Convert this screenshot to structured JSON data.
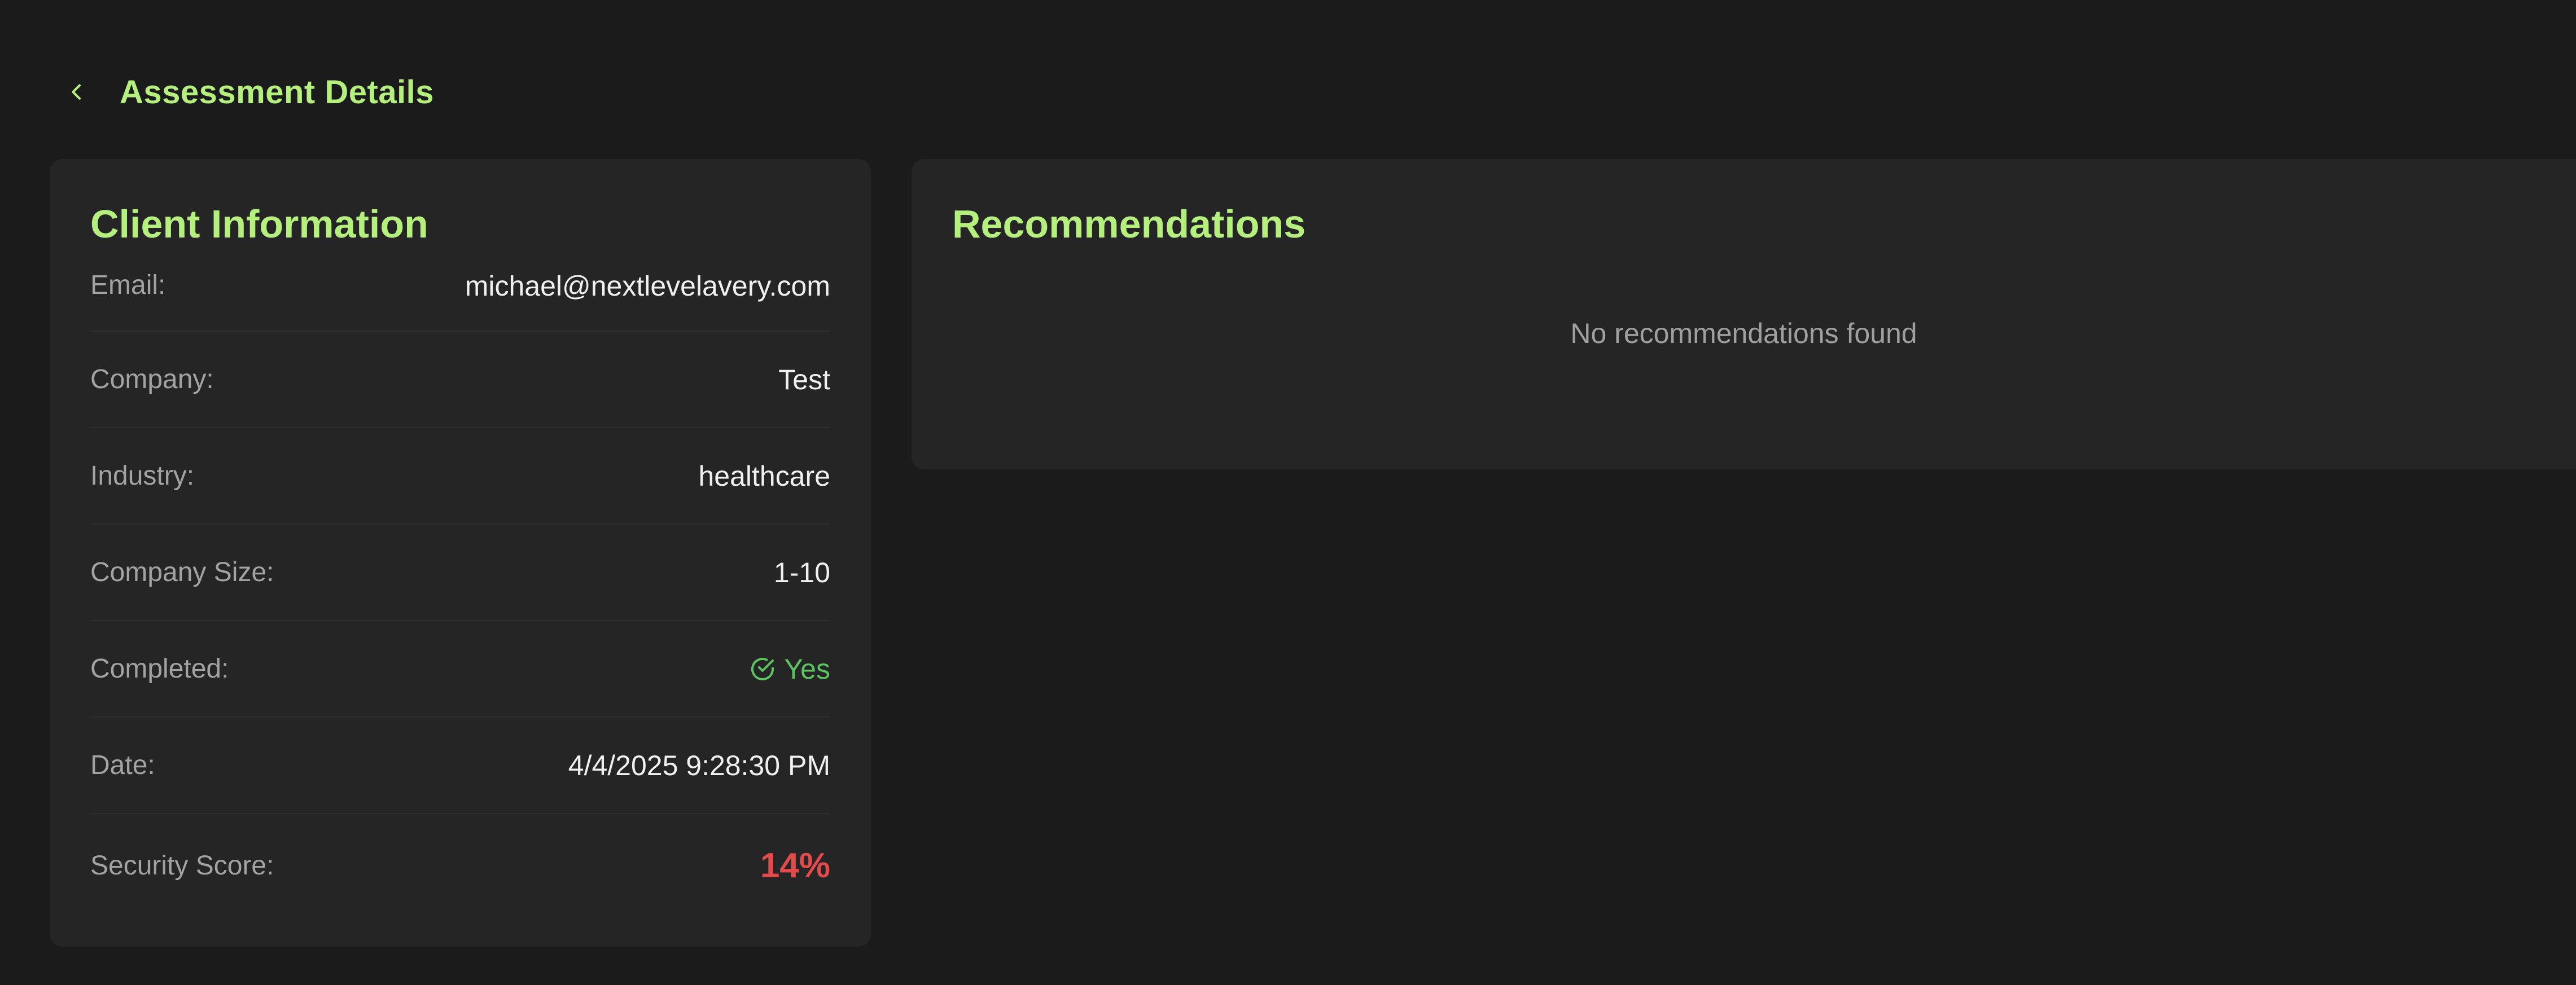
{
  "header": {
    "back_icon": "chevron-left-icon",
    "title": "Assessment Details"
  },
  "client_info": {
    "title": "Client Information",
    "rows": [
      {
        "label": "Email:",
        "value": "michael@nextlevelavery.com"
      },
      {
        "label": "Company:",
        "value": "Test"
      },
      {
        "label": "Industry:",
        "value": "healthcare"
      },
      {
        "label": "Company Size:",
        "value": "1-10"
      },
      {
        "label": "Completed:",
        "value": "Yes",
        "icon": "check-circle-icon"
      },
      {
        "label": "Date:",
        "value": "4/4/2025 9:28:30 PM"
      },
      {
        "label": "Security Score:",
        "value": "14%"
      }
    ]
  },
  "recommendations": {
    "title": "Recommendations",
    "empty_message": "No recommendations found"
  },
  "colors": {
    "background": "#1b1b1b",
    "card": "#252525",
    "accent": "#b5f07f",
    "success": "#5cc460",
    "danger": "#e14b4b"
  }
}
